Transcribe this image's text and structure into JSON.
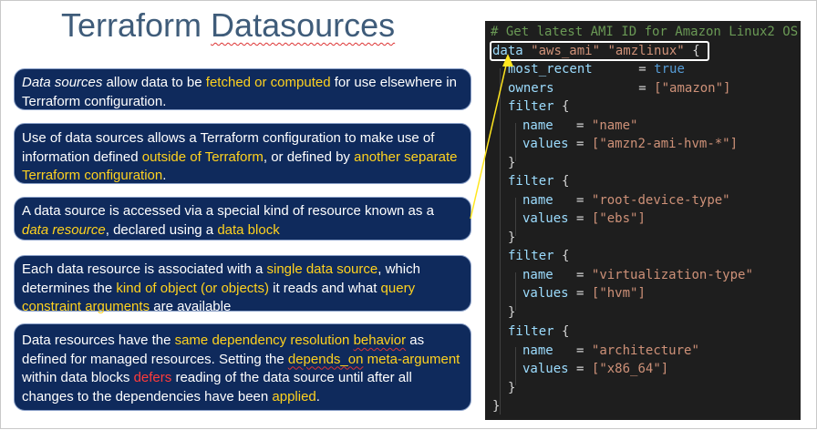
{
  "slide": {
    "title_part1": "Terraform",
    "title_part2": "Datasources"
  },
  "boxes": {
    "b1": {
      "t1": "Data sources",
      "t2": " allow data to be ",
      "t3": "fetched or computed",
      "t4": " for use elsewhere in Terraform configuration."
    },
    "b2": {
      "t1": "Use of data sources allows a Terraform configuration to make use of information defined ",
      "t2": "outside of Terraform",
      "t3": ", or defined by ",
      "t4": "another separate Terraform configuration",
      "t5": "."
    },
    "b3": {
      "t1": "A data source is accessed via a special kind of resource known as a ",
      "t2": "data resource",
      "t3": ", declared using a ",
      "t4": "data block"
    },
    "b4": {
      "t1": "Each data resource is associated with a ",
      "t2": "single data source",
      "t3": ", which determines the ",
      "t4": "kind of object (or objects)",
      "t5": " it reads and what ",
      "t6": "query constraint arguments",
      "t7": " are available"
    },
    "b5": {
      "t1": "Data resources have the ",
      "t2": "same dependency resolution ",
      "t3": "behavior",
      "t4": " as defined for managed resources. Setting the ",
      "t5": "depends_on",
      "t6": " meta-argument",
      "t7": " within data blocks ",
      "t8": "defers",
      "t9": " reading of the data source until after all changes to the dependencies  have been ",
      "t10": "applied",
      "t11": "."
    }
  },
  "code": {
    "comment": "# Get latest AMI ID for Amazon Linux2 OS",
    "l1_kw": "data",
    "l1_s1": "\"aws_ami\"",
    "l1_s2": "\"amzlinux\"",
    "l1_brace": "{",
    "most_recent_key": "most_recent",
    "most_recent_eq": "=",
    "most_recent_val": "true",
    "owners_key": "owners",
    "owners_eq": "=",
    "owners_val": "[\"amazon\"]",
    "filter_kw": "filter",
    "open_brace": "{",
    "close_brace": "}",
    "name_key": "name",
    "values_key": "values",
    "eq": "=",
    "f1_name": "\"name\"",
    "f1_values": "[\"amzn2-ami-hvm-*\"]",
    "f2_name": "\"root-device-type\"",
    "f2_values": "[\"ebs\"]",
    "f3_name": "\"virtualization-type\"",
    "f3_values": "[\"hvm\"]",
    "f4_name": "\"architecture\"",
    "f4_values": "[\"x86_64\"]",
    "final_brace": "}"
  },
  "colors": {
    "box_bg": "#0f2a5c",
    "highlight_yellow": "#ffd21f",
    "highlight_red": "#ff3b3b",
    "title": "#3f5c7a",
    "code_bg": "#1e1e1e",
    "code_comment": "#6a9955",
    "code_string": "#ce9178",
    "code_keyword": "#9cdcfe",
    "code_bool": "#569cd6"
  }
}
